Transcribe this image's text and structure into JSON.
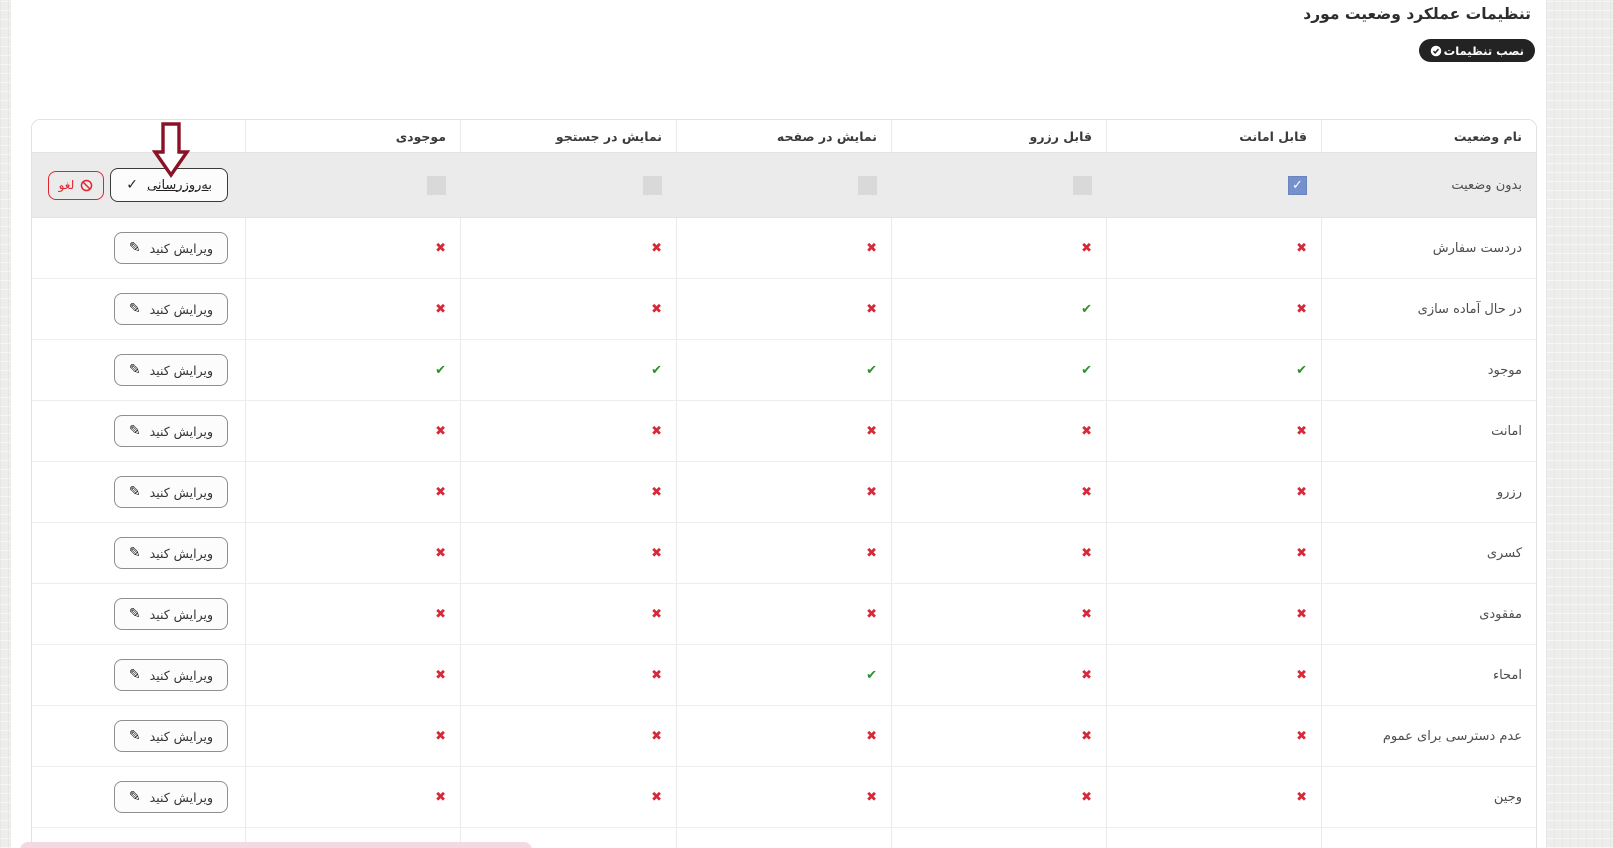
{
  "page": {
    "title": "تنظیمات عملکرد وضعیت مورد"
  },
  "toolbar": {
    "install_label": "نصب تنظیمات",
    "install_icon": "check-circle-icon"
  },
  "table": {
    "headers": {
      "name": "نام وضعیت",
      "loanable": "قابل امانت",
      "reservable": "قابل رزرو",
      "show_in_page": "نمایش در صفحه",
      "show_in_search": "نمایش در جستجو",
      "stock": "موجودی",
      "actions": ""
    },
    "column_keys": [
      "loanable",
      "reservable",
      "show_in_page",
      "show_in_search",
      "stock"
    ],
    "edit_row": {
      "name": "بدون وضعیت",
      "loanable": true,
      "reservable": false,
      "show_in_page": false,
      "show_in_search": false,
      "stock": false,
      "update_label": "به‌روزرسانی",
      "cancel_label": "لغو"
    },
    "edit_label": "ویرایش کنید",
    "rows": [
      {
        "name": "دردست سفارش",
        "loanable": false,
        "reservable": false,
        "show_in_page": false,
        "show_in_search": false,
        "stock": false
      },
      {
        "name": "در حال آماده سازی",
        "loanable": false,
        "reservable": true,
        "show_in_page": false,
        "show_in_search": false,
        "stock": false
      },
      {
        "name": "موجود",
        "loanable": true,
        "reservable": true,
        "show_in_page": true,
        "show_in_search": true,
        "stock": true
      },
      {
        "name": "امانت",
        "loanable": false,
        "reservable": false,
        "show_in_page": false,
        "show_in_search": false,
        "stock": false
      },
      {
        "name": "رزرو",
        "loanable": false,
        "reservable": false,
        "show_in_page": false,
        "show_in_search": false,
        "stock": false
      },
      {
        "name": "کسری",
        "loanable": false,
        "reservable": false,
        "show_in_page": false,
        "show_in_search": false,
        "stock": false
      },
      {
        "name": "مفقودی",
        "loanable": false,
        "reservable": false,
        "show_in_page": false,
        "show_in_search": false,
        "stock": false
      },
      {
        "name": "امحاء",
        "loanable": false,
        "reservable": false,
        "show_in_page": true,
        "show_in_search": false,
        "stock": false
      },
      {
        "name": "عدم دسترسی برای عموم",
        "loanable": false,
        "reservable": false,
        "show_in_page": false,
        "show_in_search": false,
        "stock": false
      },
      {
        "name": "وجین",
        "loanable": false,
        "reservable": false,
        "show_in_page": false,
        "show_in_search": false,
        "stock": false
      }
    ]
  },
  "icons": {
    "check": "✔",
    "cross": "✖",
    "pencil": "✎",
    "button_check": "✓"
  },
  "colors": {
    "cross_red": "#d62939",
    "check_green": "#2c912c",
    "checkbox_checked_blue": "#7591cd",
    "arrow_maroon": "#8a1226",
    "install_button_bg": "#232323",
    "cancel_red": "#e02531",
    "edit_row_bg": "#ebebeb"
  }
}
